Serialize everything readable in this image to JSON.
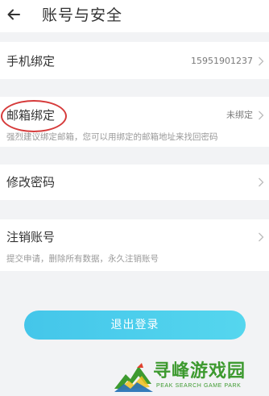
{
  "header": {
    "title": "账号与安全",
    "back_icon": "arrow-left-icon"
  },
  "rows": {
    "phone": {
      "label": "手机绑定",
      "value": "15951901237"
    },
    "email": {
      "label": "邮箱绑定",
      "value": "未绑定",
      "description": "强烈建议绑定邮箱，您可以用绑定的邮箱地址来找回密码"
    },
    "password": {
      "label": "修改密码"
    },
    "cancel_account": {
      "label": "注销账号",
      "description": "提交申请，删除所有数据，永久注销账号"
    }
  },
  "logout": {
    "label": "退出登录"
  },
  "watermark": {
    "title": "寻峰游戏园",
    "subtitle": "PEAK SEARCH GAME PARK"
  },
  "colors": {
    "accent": "#4cc9ea",
    "highlight": "#d63a3a",
    "background": "#f2f3f5",
    "watermark": "#3d9a2f"
  }
}
